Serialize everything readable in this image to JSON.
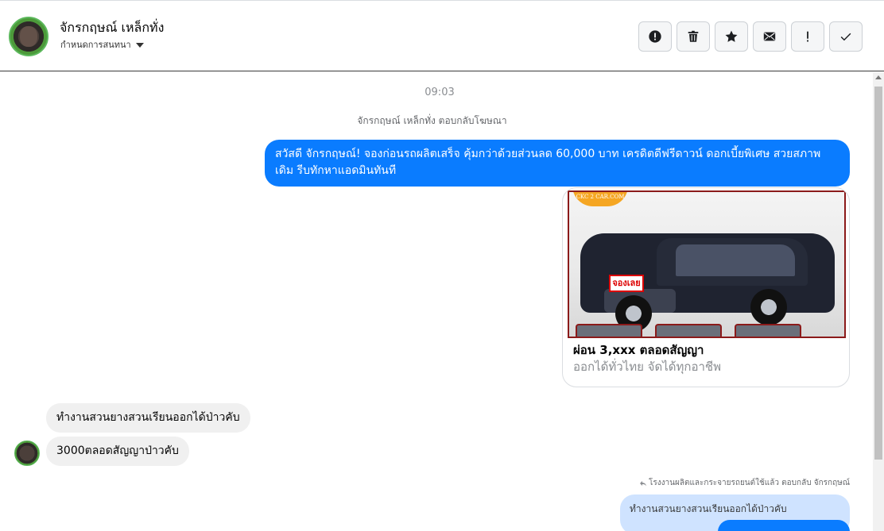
{
  "header": {
    "contact_name": "จักรกฤษณ์ เหล็กทั่ง",
    "assign_label": "กำหนดการสนทนา",
    "actions": [
      {
        "name": "report-button",
        "icon": "alert-circle-icon"
      },
      {
        "name": "delete-button",
        "icon": "trash-icon"
      },
      {
        "name": "star-button",
        "icon": "star-icon"
      },
      {
        "name": "mark-unread-button",
        "icon": "envelope-icon"
      },
      {
        "name": "follow-up-button",
        "icon": "exclamation-icon"
      },
      {
        "name": "mark-done-button",
        "icon": "check-icon"
      }
    ]
  },
  "chat": {
    "time": "09:03",
    "replied_to_ad": "จักรกฤษณ์ เหล็กทั่ง ตอบกลับโฆษณา",
    "outgoing_message": "สวัสดี จักรกฤษณ์! จองก่อนรถผลิตเสร็จ คุ้มกว่าด้วยส่วนลด 60,000 บาท เครดิตดีฟรีดาวน์ ดอกเบี้ยพิเศษ สวยสภาพเดิม รีบทักหาแอดมินทันที",
    "ad_card": {
      "logo_text": "CKC 2 CAR.COM",
      "stamp_text": "จองเลย",
      "title": "ผ่อน 3,xxx ตลอดสัญญา",
      "subtitle": "ออกได้ทั่วไทย จัดได้ทุกอาชีพ"
    },
    "incoming_messages": [
      "ทำงานสวนยางสวนเรียนออกได้ป่าวคับ",
      "3000ตลอดสัญญาป่าวคับ"
    ],
    "reply_meta": "โรงงานผลิตและกระจายรถยนต์ใช้แล้ว ตอบกลับ จักรกฤษณ์",
    "quoted_message": "ทำงานสวนยางสวนเรียนออกได้ป่าวคับ"
  },
  "colors": {
    "outgoing_bubble": "#0a7cff",
    "incoming_bubble": "#f0f0f0",
    "quote_bubble": "#cfe3ff"
  }
}
